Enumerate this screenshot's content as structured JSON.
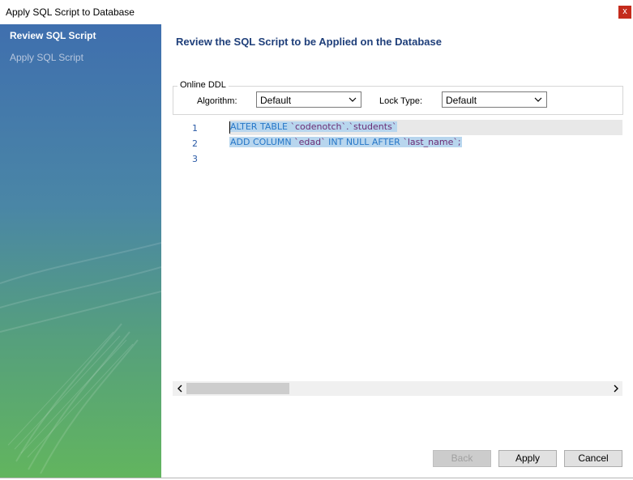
{
  "window": {
    "title": "Apply SQL Script to Database",
    "close_glyph": "x"
  },
  "sidebar": {
    "items": [
      {
        "label": "Review SQL Script",
        "active": true
      },
      {
        "label": "Apply SQL Script",
        "active": false
      }
    ]
  },
  "main": {
    "heading": "Review the SQL Script to be Applied on the Database",
    "online_ddl": {
      "legend": "Online DDL",
      "algorithm_label": "Algorithm:",
      "algorithm_value": "Default",
      "lock_type_label": "Lock Type:",
      "lock_type_value": "Default"
    },
    "editor": {
      "line_numbers": [
        "1",
        "2",
        "3"
      ],
      "line1": {
        "kw": "ALTER TABLE ",
        "s1": "`codenotch`",
        "dot": ".",
        "s2": "`students`"
      },
      "line2": {
        "kw": "ADD COLUMN ",
        "s1": "`edad`",
        "kw2": " INT NULL AFTER ",
        "s2": "`last_name`",
        "end": ";"
      }
    }
  },
  "footer": {
    "back": "Back",
    "apply": "Apply",
    "cancel": "Cancel"
  },
  "colors": {
    "heading": "#1f3f7a",
    "keyword": "#2677c8",
    "identifier": "#6b2d74",
    "selection": "#b8d6ee",
    "close": "#c42b1c"
  }
}
